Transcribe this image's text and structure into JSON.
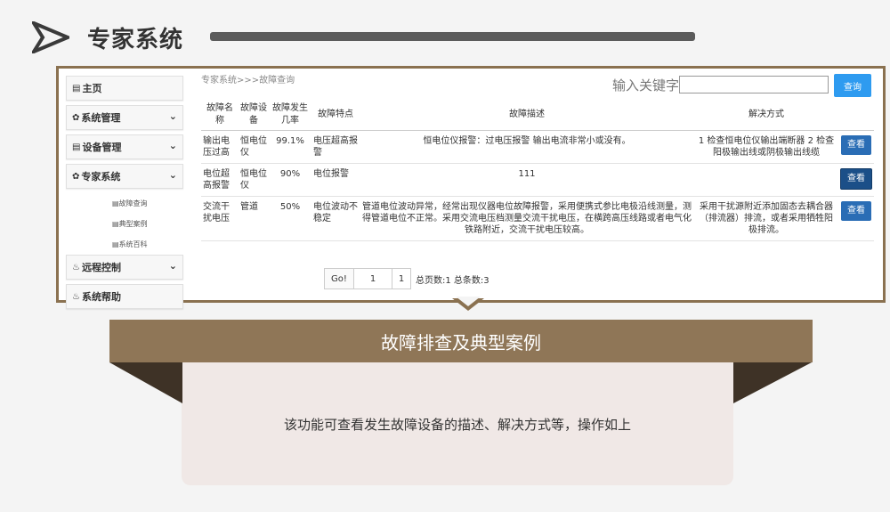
{
  "header": {
    "title": "专家系统"
  },
  "sidebar": {
    "items": [
      {
        "label": "主页",
        "icon": "home-icon"
      },
      {
        "label": "系统管理",
        "icon": "gear-icon"
      },
      {
        "label": "设备管理",
        "icon": "device-icon"
      },
      {
        "label": "专家系统",
        "icon": "gear-icon"
      },
      {
        "label": "远程控制",
        "icon": "fire-icon"
      },
      {
        "label": "系统帮助",
        "icon": "fire-icon"
      }
    ],
    "sub_items": [
      "故障查询",
      "典型案例",
      "系统百科"
    ]
  },
  "breadcrumb": "专家系统>>>故障查询",
  "search": {
    "label": "输入关键字",
    "value": "",
    "button": "查询"
  },
  "table": {
    "headers": [
      "故障名称",
      "故障设备",
      "故障发生几率",
      "故障特点",
      "故障描述",
      "解决方式",
      ""
    ],
    "rows": [
      {
        "name": "输出电压过高",
        "device": "恒电位仪",
        "rate": "99.1%",
        "feature": "电压超高报警",
        "description": "恒电位仪报警：过电压报警 输出电流非常小或没有。",
        "solution": "1 检查恒电位仪输出端断器 2 检查阳极输出线或阴极输出线缆",
        "action": "查看"
      },
      {
        "name": "电位超高报警",
        "device": "恒电位仪",
        "rate": "90%",
        "feature": "电位报警",
        "description": "111",
        "solution": "",
        "action": "查看"
      },
      {
        "name": "交流干扰电压",
        "device": "管道",
        "rate": "50%",
        "feature": "电位波动不稳定",
        "description": "管道电位波动异常，经常出现仪器电位故障报警，采用便携式参比电极沿线测量，测得管道电位不正常。采用交流电压档测量交流干扰电压，在横跨高压线路或者电气化铁路附近，交流干扰电压较高。",
        "solution": "采用干扰源附近添加固态去耦合器（排流器）排流，或者采用牺牲阳极排流。",
        "action": "查看"
      }
    ]
  },
  "pager": {
    "go": "Go!",
    "page_input": "1",
    "current": "1",
    "info": "总页数:1 总条数:3"
  },
  "banner": {
    "title": "故障排查及典型案例",
    "description": "该功能可查看发生故障设备的描述、解决方式等，操作如上"
  },
  "colors": {
    "frame": "#8a7150",
    "banner": "#8f7657",
    "banner_dark": "#3e3226",
    "card": "#f0e8e6",
    "button": "#2a6db5",
    "query": "#2e9bf0"
  }
}
